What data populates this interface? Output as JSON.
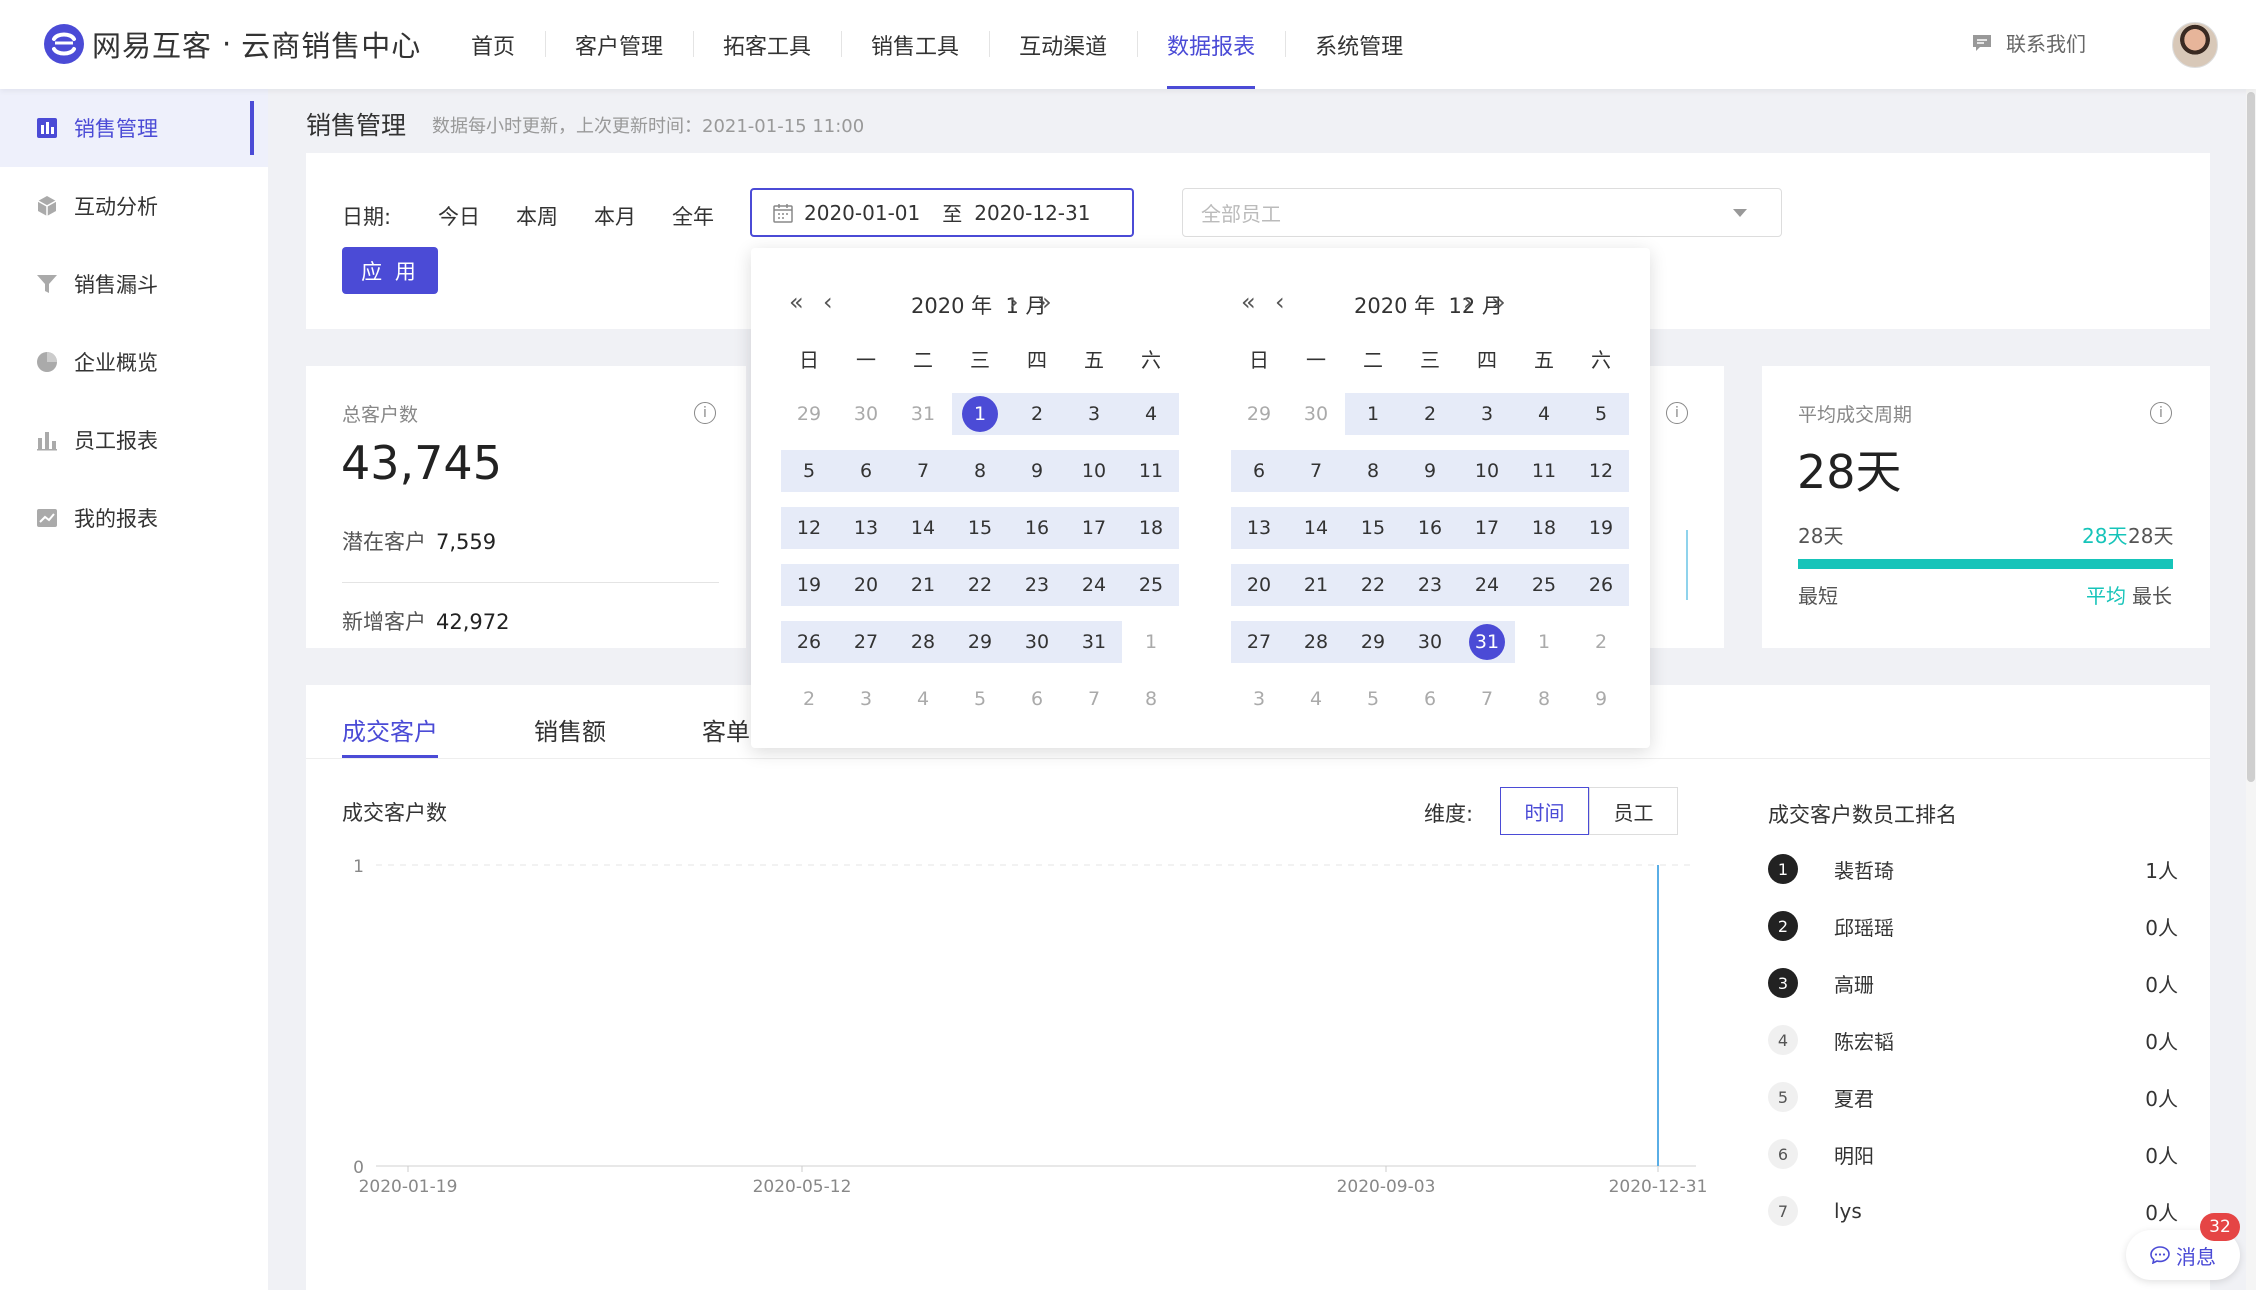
{
  "brand": {
    "name": "网易互客",
    "dot": "·",
    "sub": "云商销售中心"
  },
  "nav": [
    "首页",
    "客户管理",
    "拓客工具",
    "销售工具",
    "互动渠道",
    "数据报表",
    "系统管理"
  ],
  "contact": "联系我们",
  "sidebar": [
    "销售管理",
    "互动分析",
    "销售漏斗",
    "企业概览",
    "员工报表",
    "我的报表"
  ],
  "page": {
    "title": "销售管理",
    "note": "数据每小时更新，上次更新时间：2021-01-15 11:00"
  },
  "filter": {
    "date_label": "日期:",
    "opts": [
      "今日",
      "本周",
      "本月",
      "全年"
    ],
    "start": "2020-01-01",
    "to": "至",
    "end": "2020-12-31",
    "emp_placeholder": "全部员工",
    "apply": "应 用"
  },
  "stats": {
    "total": {
      "label": "总客户数",
      "value": "43,745",
      "potential_label": "潜在客户",
      "potential": "7,559",
      "new_label": "新增客户",
      "new": "42,972"
    },
    "cycle": {
      "label": "平均成交周期",
      "value": "28天",
      "min": "28天",
      "avg": "28天",
      "max": "28天",
      "min_label": "最短",
      "avg_label": "平均",
      "max_label": "最长",
      "avg_fraction": 1.0
    }
  },
  "tabs": [
    "成交客户",
    "销售额",
    "客单"
  ],
  "chart_title": "成交客户数",
  "dimension": {
    "label": "维度:",
    "opts": [
      "时间",
      "员工"
    ]
  },
  "ranking": {
    "title": "成交客户数员工排名",
    "rows": [
      {
        "no": "1",
        "name": "裴哲琦",
        "val": "1人"
      },
      {
        "no": "2",
        "name": "邱瑶瑶",
        "val": "0人"
      },
      {
        "no": "3",
        "name": "高珊",
        "val": "0人"
      },
      {
        "no": "4",
        "name": "陈宏韬",
        "val": "0人"
      },
      {
        "no": "5",
        "name": "夏君",
        "val": "0人"
      },
      {
        "no": "6",
        "name": "明阳",
        "val": "0人"
      },
      {
        "no": "7",
        "name": "lys",
        "val": "0人"
      }
    ]
  },
  "calendar": {
    "left": {
      "year": "2020 年",
      "month": "1 月"
    },
    "right": {
      "year": "2020 年",
      "month": "12 月"
    },
    "weekdays": [
      "日",
      "一",
      "二",
      "三",
      "四",
      "五",
      "六"
    ],
    "left_days": [
      "29",
      "30",
      "31",
      "1",
      "2",
      "3",
      "4",
      "5",
      "6",
      "7",
      "8",
      "9",
      "10",
      "11",
      "12",
      "13",
      "14",
      "15",
      "16",
      "17",
      "18",
      "19",
      "20",
      "21",
      "22",
      "23",
      "24",
      "25",
      "26",
      "27",
      "28",
      "29",
      "30",
      "31",
      "1",
      "2",
      "3",
      "4",
      "5",
      "6",
      "7",
      "8"
    ],
    "right_days": [
      "29",
      "30",
      "1",
      "2",
      "3",
      "4",
      "5",
      "6",
      "7",
      "8",
      "9",
      "10",
      "11",
      "12",
      "13",
      "14",
      "15",
      "16",
      "17",
      "18",
      "19",
      "20",
      "21",
      "22",
      "23",
      "24",
      "25",
      "26",
      "27",
      "28",
      "29",
      "30",
      "31",
      "1",
      "2",
      "3",
      "4",
      "5",
      "6",
      "7",
      "8",
      "9"
    ]
  },
  "chart_data": {
    "type": "line",
    "x": [
      "2020-01-19",
      "2020-05-12",
      "2020-09-03",
      "2020-12-31"
    ],
    "y_ticks": [
      "1",
      "0"
    ],
    "ylim": [
      0,
      1
    ],
    "series": [
      {
        "points": [
          [
            "2020-12-31",
            1
          ]
        ]
      }
    ]
  },
  "message": {
    "label": "消息",
    "badge": "32"
  },
  "colors": {
    "accent": "#4b4bd6",
    "teal": "#16c4b9",
    "range": "#e6ebf8"
  }
}
